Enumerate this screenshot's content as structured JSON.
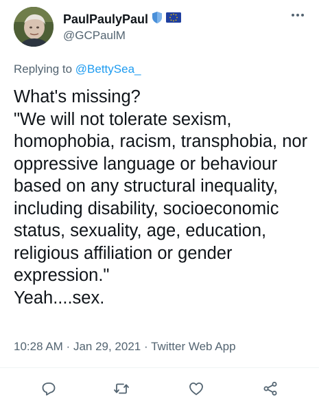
{
  "user": {
    "display_name": "PaulPaulyPaul",
    "handle": "@GCPaulM",
    "avatar_icon": "avatar-photo",
    "badges": [
      "shield-icon",
      "eu-flag-icon"
    ]
  },
  "reply": {
    "prefix": "Replying to ",
    "mention": "@BettySea_"
  },
  "tweet": {
    "text": "What's missing?\n\"We will not tolerate sexism, homophobia, racism, transphobia, nor oppressive language or behaviour based on any structural inequality, including disability, socioeconomic status, sexuality, age, education, religious affiliation or gender expression.\"\nYeah....sex."
  },
  "meta": {
    "time": "10:28 AM",
    "sep1": " · ",
    "date": "Jan 29, 2021",
    "sep2": " · ",
    "source": "Twitter Web App"
  },
  "actions": [
    "reply-icon",
    "retweet-icon",
    "like-icon",
    "share-icon"
  ],
  "colors": {
    "text": "#0f1419",
    "secondary": "#536471",
    "accent": "#1d9bf0",
    "shield": "#4a90d9",
    "eu_blue": "#1f3f9f",
    "eu_star": "#f5c400"
  }
}
